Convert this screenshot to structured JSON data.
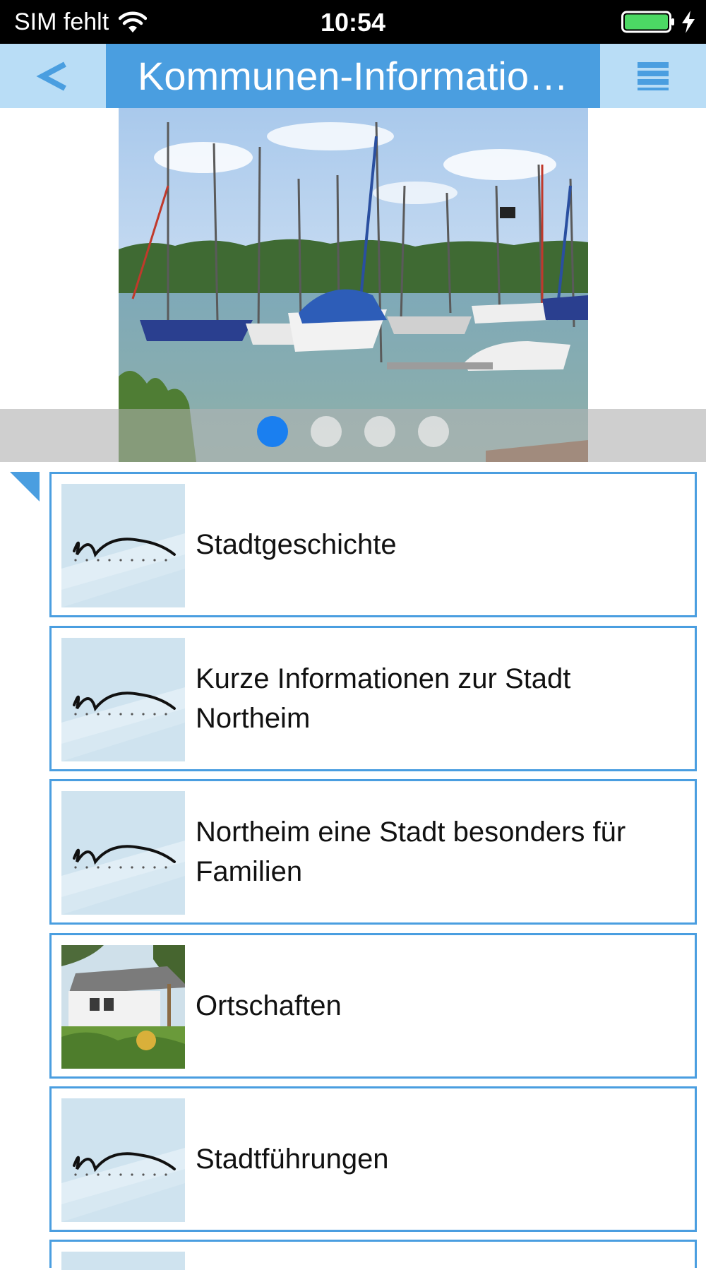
{
  "status_bar": {
    "carrier": "SIM fehlt",
    "time": "10:54",
    "battery_color": "#4cd964"
  },
  "nav": {
    "back_label": "<",
    "title": "Kommunen-Informatio…",
    "back_icon": "chevron-left-icon",
    "menu_icon": "hamburger-menu-icon",
    "accent": "#4a9ee0"
  },
  "carousel": {
    "image": "marina-sailboats-photo",
    "slide_count": 4,
    "active_index": 0
  },
  "list": {
    "items": [
      {
        "label": "Stadtgeschichte",
        "thumb": "northeim-logo"
      },
      {
        "label": "Kurze Informationen zur Stadt Northeim",
        "thumb": "northeim-logo"
      },
      {
        "label": "Northeim eine Stadt besonders für Familien",
        "thumb": "northeim-logo"
      },
      {
        "label": "Ortschaften",
        "thumb": "building-photo"
      },
      {
        "label": "Stadtführungen",
        "thumb": "northeim-logo"
      }
    ]
  }
}
